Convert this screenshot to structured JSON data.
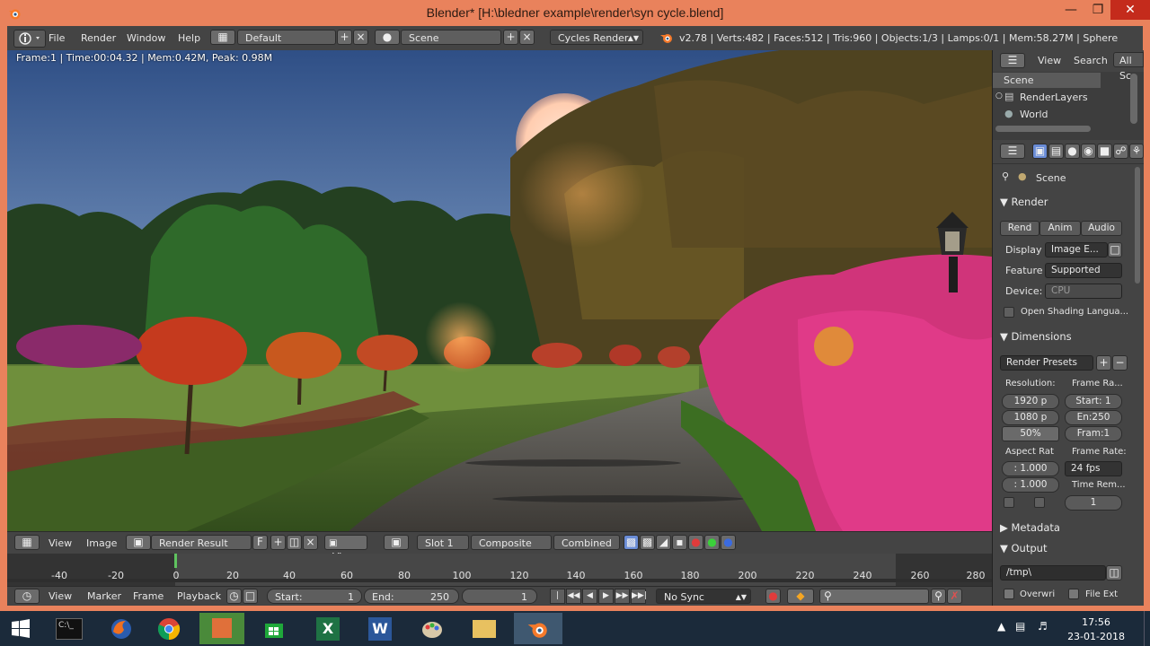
{
  "window": {
    "title": "Blender* [H:\\bledner example\\render\\syn cycle.blend]"
  },
  "infobar": {
    "menus": [
      "File",
      "Render",
      "Window",
      "Help"
    ],
    "layout": "Default",
    "scene": "Scene",
    "engine": "Cycles Render",
    "stats": "v2.78 | Verts:482 | Faces:512 | Tris:960 | Objects:1/3 | Lamps:0/1 | Mem:58.27M | Sphere"
  },
  "render": {
    "info": "Frame:1 | Time:00:04.32 | Mem:0.42M, Peak: 0.98M"
  },
  "image_header": {
    "view": "View",
    "image": "Image",
    "image_name": "Render Result",
    "fake_user": "F",
    "view2": "View",
    "slot": "Slot 1",
    "composite": "Composite",
    "pass": "Combined"
  },
  "timeline": {
    "ticks": [
      "-40",
      "-20",
      "0",
      "20",
      "40",
      "60",
      "80",
      "100",
      "120",
      "140",
      "160",
      "180",
      "200",
      "220",
      "240",
      "260",
      "280"
    ],
    "menus": [
      "View",
      "Marker",
      "Frame",
      "Playback"
    ],
    "start_label": "Start:",
    "start_value": "1",
    "end_label": "End:",
    "end_value": "250",
    "current_frame": "1",
    "sync": "No Sync"
  },
  "outliner": {
    "view": "View",
    "search": "Search",
    "filter": "All Sc",
    "items": [
      "Scene",
      "RenderLayers",
      "World"
    ]
  },
  "properties": {
    "context": "Scene",
    "render_panel": "Render",
    "render_buttons": [
      "Rend",
      "Anim",
      "Audio"
    ],
    "display_label": "Display",
    "display_value": "Image E...",
    "feature_label": "Feature",
    "feature_value": "Supported",
    "device_label": "Device:",
    "device_value": "CPU",
    "osl_label": "Open Shading Langua...",
    "dimensions_panel": "Dimensions",
    "presets": "Render Presets",
    "resolution_label": "Resolution:",
    "frame_range_label": "Frame Ra...",
    "res_x": "1920 p",
    "res_y": "1080 p",
    "res_pct": "50%",
    "frame_start": "Start: 1",
    "frame_end": "En:250",
    "frame_step": "Fram:1",
    "aspect_label": "Aspect Rat",
    "framerate_label": "Frame Rate:",
    "aspect_x": ": 1.000",
    "aspect_y": ": 1.000",
    "fps": "24 fps",
    "time_remap_label": "Time Rem...",
    "time_remap_value": "1",
    "metadata_panel": "Metadata",
    "output_panel": "Output",
    "output_path": "/tmp\\",
    "overwrite": "Overwri",
    "file_ext": "File Ext"
  },
  "taskbar": {
    "time": "17:56",
    "date": "23-01-2018"
  },
  "colors": {
    "title_bar": "#e9825c",
    "header": "#444444",
    "panel": "#3d3d3d",
    "taskbar": "#1b2a3a",
    "timeline_cursor": "#5fc35f"
  }
}
